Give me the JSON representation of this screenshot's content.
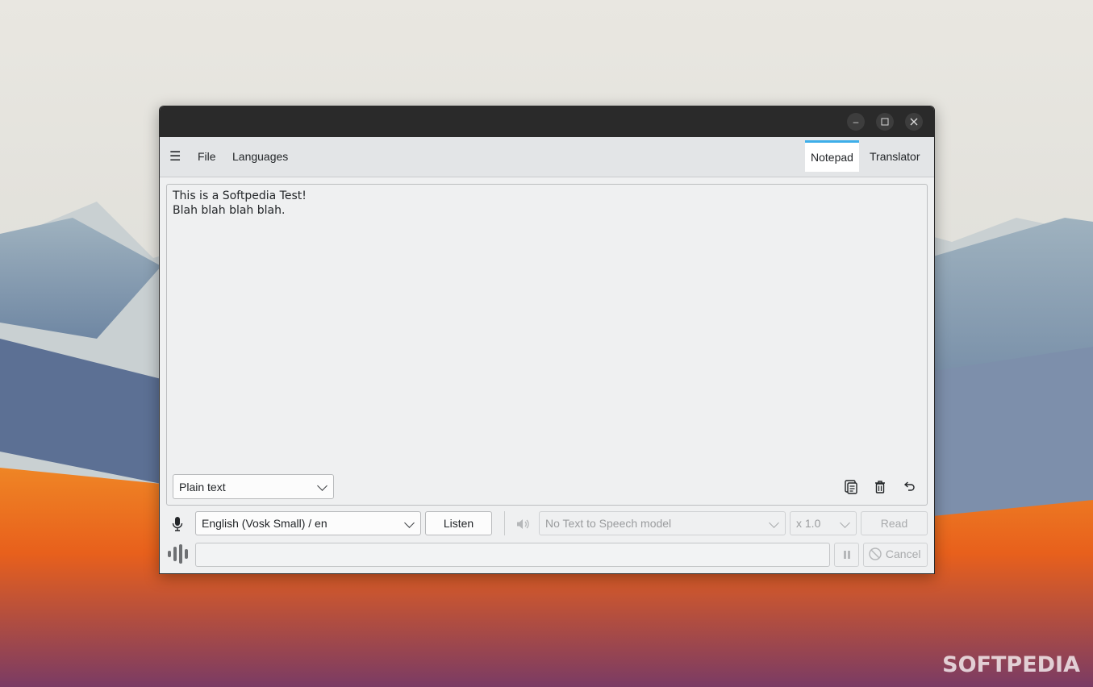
{
  "window": {
    "controls": [
      "minimize",
      "maximize",
      "close"
    ]
  },
  "menu": {
    "items": [
      "File",
      "Languages"
    ],
    "menu_icon": "hamburger-icon"
  },
  "tabs": [
    {
      "label": "Notepad",
      "active": true
    },
    {
      "label": "Translator",
      "active": false
    }
  ],
  "editor": {
    "text": "This is a Softpedia Test!\nBlah blah blah blah."
  },
  "format_select": {
    "value": "Plain text"
  },
  "editor_actions": [
    "copy-icon",
    "delete-icon",
    "undo-icon"
  ],
  "speech": {
    "stt_model": "English (Vosk Small) / en",
    "listen_label": "Listen",
    "tts_model": "No Text to Speech model",
    "speed": "x 1.0",
    "read_label": "Read",
    "cancel_label": "Cancel",
    "progress": 0
  },
  "watermark": "SOFTPEDIA",
  "colors": {
    "accent": "#3daee9",
    "titlebar": "#2a2a2a"
  }
}
